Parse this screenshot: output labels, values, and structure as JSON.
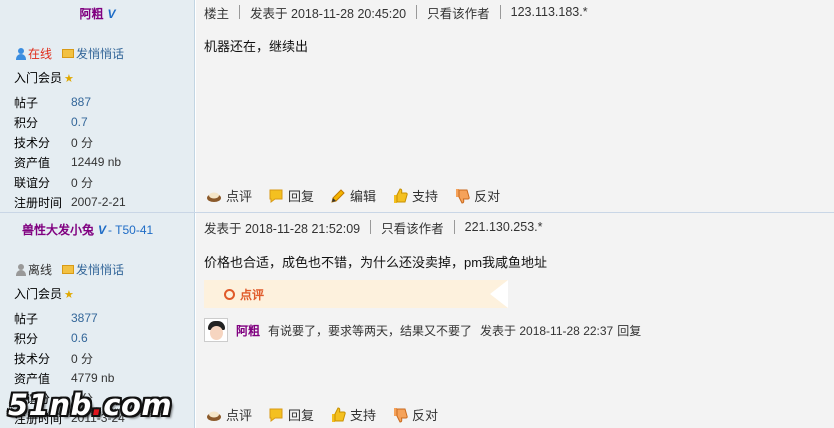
{
  "post1": {
    "author": {
      "name": "阿粗",
      "vip": "V"
    },
    "status": {
      "online": "在线",
      "pm": "发悄悄话"
    },
    "group": "入门会员",
    "stats": [
      {
        "k": "帖子",
        "v": "887",
        "link": true
      },
      {
        "k": "积分",
        "v": "0.7",
        "link": true
      },
      {
        "k": "技术分",
        "v": "0 分",
        "link": false
      },
      {
        "k": "资产值",
        "v": "12449 nb",
        "link": false
      },
      {
        "k": "联谊分",
        "v": "0 分",
        "link": false
      },
      {
        "k": "注册时间",
        "v": "2007-2-21",
        "link": false
      }
    ],
    "header": {
      "floor": "楼主",
      "posted": "发表于 2018-11-28 20:45:20",
      "only_author": "只看该作者",
      "ip": "123.113.183.*"
    },
    "content": "机器还在，继续出",
    "actions": {
      "comment": "点评",
      "reply": "回复",
      "edit": "编辑",
      "support": "支持",
      "oppose": "反对"
    }
  },
  "post2": {
    "author": {
      "name": "兽性大发小兔",
      "vip": "V",
      "tag": "- T50-41"
    },
    "status": {
      "offline": "离线",
      "pm": "发悄悄话"
    },
    "group": "入门会员",
    "stats": [
      {
        "k": "帖子",
        "v": "3877",
        "link": true
      },
      {
        "k": "积分",
        "v": "0.6",
        "link": true
      },
      {
        "k": "技术分",
        "v": "0 分",
        "link": false
      },
      {
        "k": "资产值",
        "v": "4779 nb",
        "link": false
      },
      {
        "k": "联谊分",
        "v": "0 分",
        "link": false
      },
      {
        "k": "注册时间",
        "v": "2011-3-24",
        "link": false
      }
    ],
    "header": {
      "posted": "发表于 2018-11-28 21:52:09",
      "only_author": "只看该作者",
      "ip": "221.130.253.*"
    },
    "content": "价格也合适，成色也不错，为什么还没卖掉，pm我咸鱼地址",
    "comment_label": "点评",
    "reply": {
      "who": "阿粗",
      "text": "有说要了，要求等两天，结果又不要了",
      "time": "发表于 2018-11-28 22:37",
      "reply_link": "回复"
    },
    "actions": {
      "comment": "点评",
      "reply": "回复",
      "support": "支持",
      "oppose": "反对"
    }
  },
  "watermark": {
    "pre": "51nb",
    "dot": ".",
    "post": "com"
  },
  "colors": {
    "sidebar": "#e5edf2",
    "content_bg": "#f3f3f3",
    "username": "#800080",
    "link": "#336699",
    "online": "#e02c1a"
  }
}
